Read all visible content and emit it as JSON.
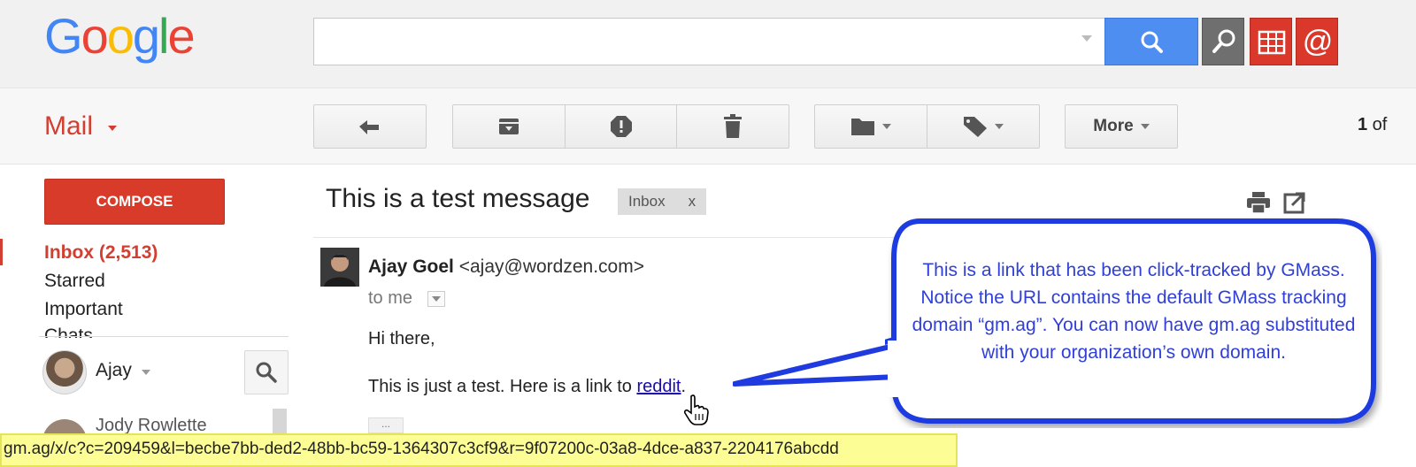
{
  "header": {
    "logo_letters": [
      "G",
      "o",
      "o",
      "g",
      "l",
      "e"
    ],
    "logo_colors": [
      "#4285f4",
      "#ea4335",
      "#fbbc05",
      "#4285f4",
      "#34a853",
      "#ea4335"
    ],
    "search_value": "",
    "search_button_color": "#4d8ef0"
  },
  "toolbar": {
    "app_label": "Mail",
    "more_label": "More",
    "counter_bold": "1",
    "counter_rest": " of"
  },
  "nav": {
    "compose_label": "COMPOSE",
    "items": [
      {
        "label": "Inbox (2,513)",
        "active": true
      },
      {
        "label": "Starred"
      },
      {
        "label": "Important"
      },
      {
        "label": "Chats"
      }
    ],
    "hangouts_user": "Ajay",
    "contact_name": "Jody Rowlette"
  },
  "message": {
    "subject": "This is a test message",
    "label_chip": "Inbox",
    "label_chip_close": "x",
    "sender_name": "Ajay Goel",
    "sender_email": "<ajay@wordzen.com>",
    "recipient": "to me",
    "greeting": "Hi there,",
    "body_prefix": "This is just a test. Here is a link to ",
    "link_text": "reddit",
    "body_suffix": ".",
    "ellipsis": "..."
  },
  "callout": {
    "text": "This is a link that has been click-tracked by GMass. Notice the URL contains the default GMass tracking domain “gm.ag”. You can now have gm.ag substituted with your organization’s own domain.",
    "border_color": "#1f3be0",
    "text_color": "#2f3fd8"
  },
  "status_bar": {
    "url": "gm.ag/x/c?c=209459&l=becbe7bb-ded2-48bb-bc59-1364307c3cf9&r=9f07200c-03a8-4dce-a837-2204176abcdd"
  },
  "icons": {
    "search": "search-icon",
    "extension_1": "magnifier-extension-icon",
    "extension_2": "spreadsheet-extension-icon",
    "extension_3": "gmass-at-icon",
    "reply": "reply-icon",
    "archive": "archive-icon",
    "spam": "report-spam-icon",
    "delete": "trash-icon",
    "move": "folder-icon",
    "labels": "label-tag-icon",
    "print": "print-icon",
    "new_window": "new-window-icon"
  }
}
